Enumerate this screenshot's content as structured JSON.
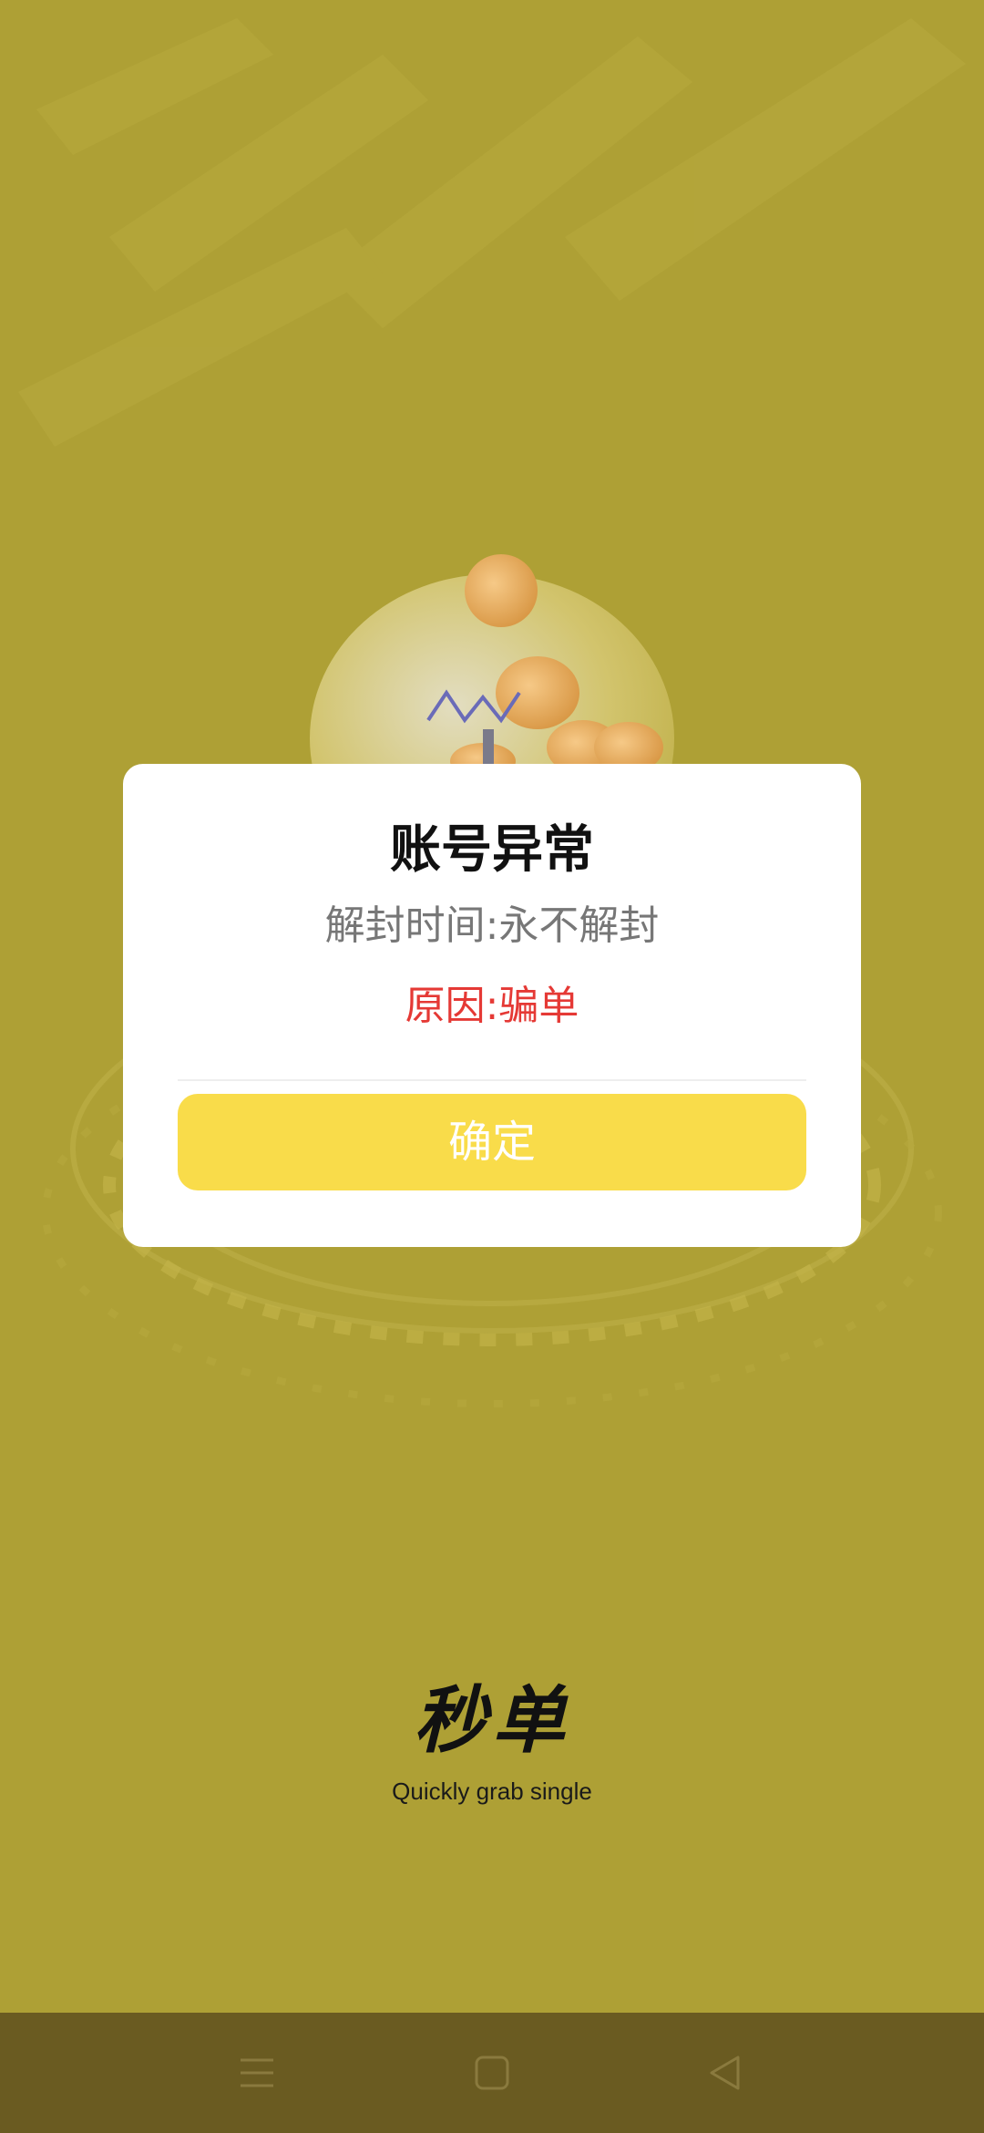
{
  "dialog": {
    "title": "账号异常",
    "unblock_time": "解封时间:永不解封",
    "reason": "原因:骗单",
    "confirm_label": "确定"
  },
  "brand": {
    "logo_text": "秒单",
    "slogan": "Quickly grab single"
  },
  "nav": {
    "icons": [
      "menu-icon",
      "home-icon",
      "back-icon"
    ]
  },
  "colors": {
    "background": "#aea035",
    "dialog": "#ffffff",
    "button": "#f9dc4a",
    "reason_text": "#e53935",
    "nav_bar": "#6a5b21"
  }
}
